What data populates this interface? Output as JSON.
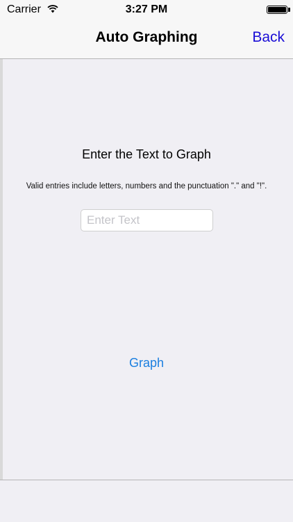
{
  "status_bar": {
    "carrier": "Carrier",
    "time": "3:27 PM",
    "wifi_icon": "wifi-icon",
    "battery_icon": "battery-icon",
    "battery_level": 1.0
  },
  "nav_bar": {
    "title": "Auto Graphing",
    "back_label": "Back"
  },
  "main": {
    "heading": "Enter the Text to Graph",
    "hint": "Valid entries include letters, numbers and the punctuation \".\" and \"!\".",
    "input": {
      "value": "",
      "placeholder": "Enter Text"
    },
    "graph_label": "Graph"
  },
  "colors": {
    "accent": "#1b7fe0",
    "back_link": "#1a0dd6",
    "background": "#f0eff4",
    "bar_background": "#f7f7f7"
  }
}
